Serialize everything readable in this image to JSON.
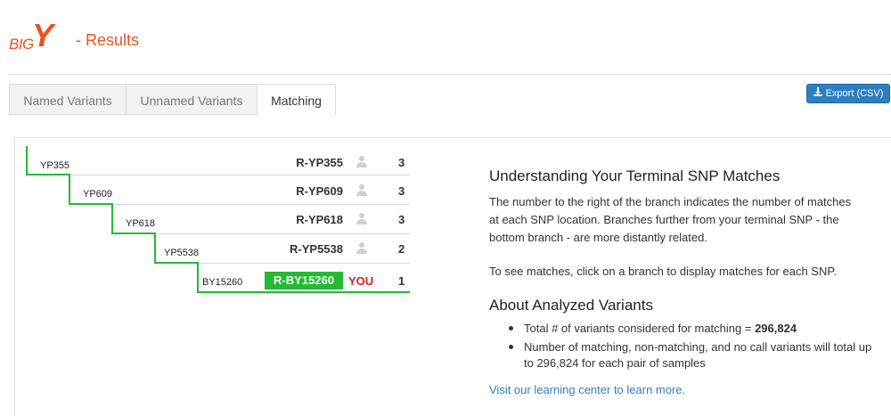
{
  "header": {
    "logo_big": "BIG",
    "logo_y": "Y",
    "title": "- Results"
  },
  "tabs": [
    {
      "label": "Named Variants",
      "active": false
    },
    {
      "label": "Unnamed Variants",
      "active": false
    },
    {
      "label": "Matching",
      "active": true
    }
  ],
  "export_button": {
    "label": "Export (CSV)",
    "icon": "download-icon"
  },
  "tree": {
    "branches": [
      {
        "snp": "YP355",
        "name": "R-YP355",
        "count": "3"
      },
      {
        "snp": "YP609",
        "name": "R-YP609",
        "count": "3"
      },
      {
        "snp": "YP618",
        "name": "R-YP618",
        "count": "3"
      },
      {
        "snp": "YP5538",
        "name": "R-YP5538",
        "count": "2"
      }
    ],
    "terminal": {
      "snp": "BY15260",
      "name": "R-BY15260",
      "you_label": "YOU",
      "count": "1"
    },
    "accent_color": "#22bb33",
    "you_color": "#d9221c"
  },
  "info": {
    "understanding_title": "Understanding Your Terminal SNP Matches",
    "understanding_text": "The number to the right of the branch indicates the number of matches at each SNP location. Branches further from your terminal SNP - the bottom branch - are more distantly related.",
    "matches_text": "To see matches, click on a branch to display matches for each SNP.",
    "analyzed_title": "About Analyzed Variants",
    "bullet1_prefix": "Total # of variants considered for matching = ",
    "bullet1_value": "296,824",
    "bullet2": "Number of matching, non-matching, and no call variants will total up to 296,824 for each pair of samples",
    "learn_link": "Visit our learning center to learn more."
  },
  "colors": {
    "brand": "#e8531f",
    "link": "#2e7ec2"
  }
}
